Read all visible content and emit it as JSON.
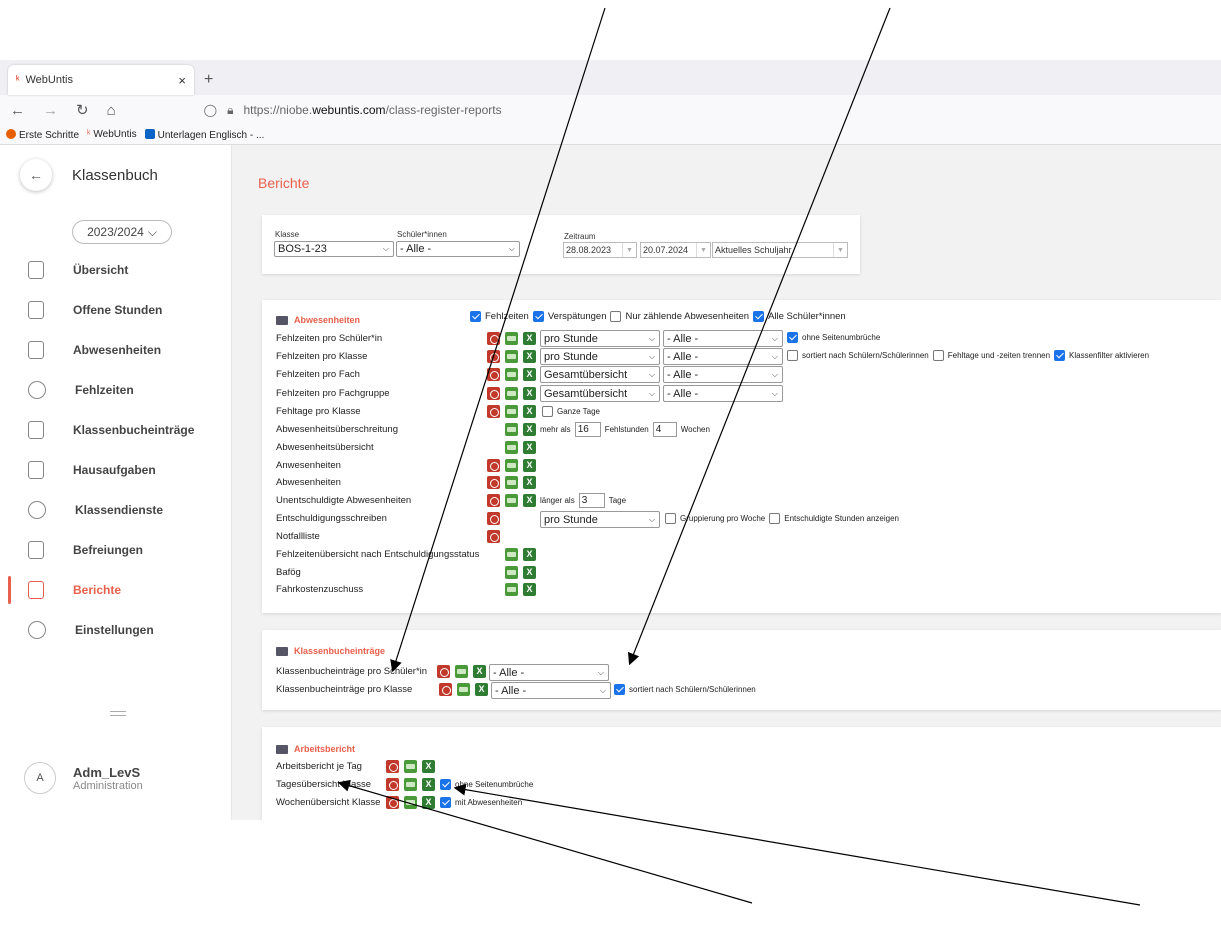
{
  "browser": {
    "tab_title": "WebUntis",
    "url_prefix": "https://niobe.",
    "url_domain": "webuntis.com",
    "url_path": "/class-register-reports",
    "bookmarks": [
      "Erste Schritte",
      "WebUntis",
      "Unterlagen Englisch - ..."
    ]
  },
  "sidebar": {
    "title": "Klassenbuch",
    "year": "2023/2024",
    "items": [
      {
        "label": "Übersicht"
      },
      {
        "label": "Offene Stunden"
      },
      {
        "label": "Abwesenheiten"
      },
      {
        "label": "Fehlzeiten"
      },
      {
        "label": "Klassenbucheinträge"
      },
      {
        "label": "Hausaufgaben"
      },
      {
        "label": "Klassendienste"
      },
      {
        "label": "Befreiungen"
      },
      {
        "label": "Berichte"
      },
      {
        "label": "Einstellungen"
      }
    ],
    "user": {
      "initial": "A",
      "name": "Adm_LevS",
      "role": "Administration"
    }
  },
  "main": {
    "title": "Berichte",
    "filter": {
      "klasse_label": "Klasse",
      "klasse_value": "BOS-1-23",
      "schueler_label": "Schüler*innen",
      "schueler_value": "- Alle -",
      "zeitraum_label": "Zeitraum",
      "date_from": "28.08.2023",
      "date_to": "20.07.2024",
      "period": "Aktuelles Schuljahr"
    },
    "abwesenheiten": {
      "title": "Abwesenheiten",
      "opts": [
        "Fehlzeiten",
        "Verspätungen",
        "Nur zählende Abwesenheiten",
        "Alle Schüler*innen"
      ],
      "rows": [
        "Fehlzeiten pro Schüler*in",
        "Fehlzeiten pro Klasse",
        "Fehlzeiten pro Fach",
        "Fehlzeiten pro Fachgruppe",
        "Fehltage pro Klasse",
        "Abwesenheitsüberschreitung",
        "Abwesenheitsübersicht",
        "Anwesenheiten",
        "Abwesenheiten",
        "Unentschuldigte Abwesenheiten",
        "Entschuldigungsschreiben",
        "Notfallliste",
        "Fehlzeitenübersicht nach Entschuldigungsstatus",
        "Bafög",
        "Fahrkostenzuschuss"
      ],
      "sel_pro_stunde": "pro Stunde",
      "sel_gesamt": "Gesamtübersicht",
      "sel_alle": "- Alle -",
      "ohne_seitenumbrueche": "ohne Seitenumbrüche",
      "sortiert": "sortiert nach Schülern/Schülerinnen",
      "fehltage_trennen": "Fehltage und -zeiten trennen",
      "klassenfilter": "Klassenfilter aktivieren",
      "ganze_tage": "Ganze Tage",
      "mehr_als": "mehr als",
      "mehr_als_val": "16",
      "fehlstunden": "Fehlstunden",
      "wochen_val": "4",
      "wochen": "Wochen",
      "laenger_als": "länger als",
      "laenger_val": "3",
      "tage": "Tage",
      "gruppierung": "Gruppierung pro Woche",
      "entsch_stunden": "Entschuldigte Stunden anzeigen"
    },
    "klassenbuch": {
      "title": "Klassenbucheinträge",
      "rows": [
        "Klassenbucheinträge pro Schüler*in",
        "Klassenbucheinträge pro Klasse"
      ],
      "sel_alle": "- Alle -",
      "sortiert": "sortiert nach Schülern/Schülerinnen"
    },
    "arbeitsbericht": {
      "title": "Arbeitsbericht",
      "rows": [
        "Arbeitsbericht je Tag",
        "Tagesübersicht Klasse",
        "Wochenübersicht Klasse"
      ],
      "ohne": "ohne Seitenumbrüche",
      "mit": "mit Abwesenheiten"
    }
  },
  "colors": {
    "accent": "#e8604c",
    "checkbox": "#1a73e8"
  }
}
